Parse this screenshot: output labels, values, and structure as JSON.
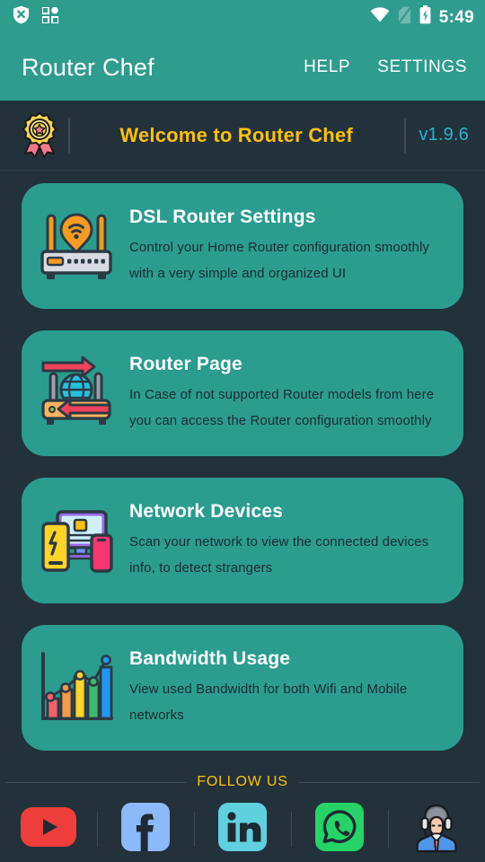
{
  "statusbar": {
    "time": "5:49",
    "icons": [
      "shield-x-icon",
      "app-grid-icon",
      "wifi-icon",
      "sim-card-off-icon",
      "battery-charging-icon"
    ]
  },
  "appbar": {
    "title": "Router Chef",
    "help_label": "HELP",
    "settings_label": "SETTINGS"
  },
  "banner": {
    "badge_icon": "award-badge-icon",
    "title": "Welcome to Router Chef",
    "version": "v1.9.6"
  },
  "cards": [
    {
      "icon": "dsl-router-icon",
      "title": "DSL Router Settings",
      "desc": "Control your Home Router configuration smoothly with a very simple and organized UI"
    },
    {
      "icon": "router-page-icon",
      "title": "Router Page",
      "desc": "In Case of not supported Router models from here you can access the Router configuration smoothly"
    },
    {
      "icon": "network-devices-icon",
      "title": "Network Devices",
      "desc": "Scan your network to view the connected devices info, to detect strangers"
    },
    {
      "icon": "bandwidth-chart-icon",
      "title": "Bandwidth Usage",
      "desc": "View used Bandwidth for both Wifi and Mobile networks"
    }
  ],
  "footer": {
    "follow_label": "FOLLOW US",
    "socials": [
      {
        "name": "youtube-icon"
      },
      {
        "name": "facebook-icon"
      },
      {
        "name": "linkedin-icon"
      },
      {
        "name": "whatsapp-icon"
      },
      {
        "name": "support-agent-icon"
      }
    ]
  },
  "colors": {
    "accent_teal": "#2E9D8E",
    "card_teal": "#2A9D8F",
    "background": "#22313A",
    "banner_yellow": "#FFC107",
    "version_cyan": "#1FB6CE"
  }
}
